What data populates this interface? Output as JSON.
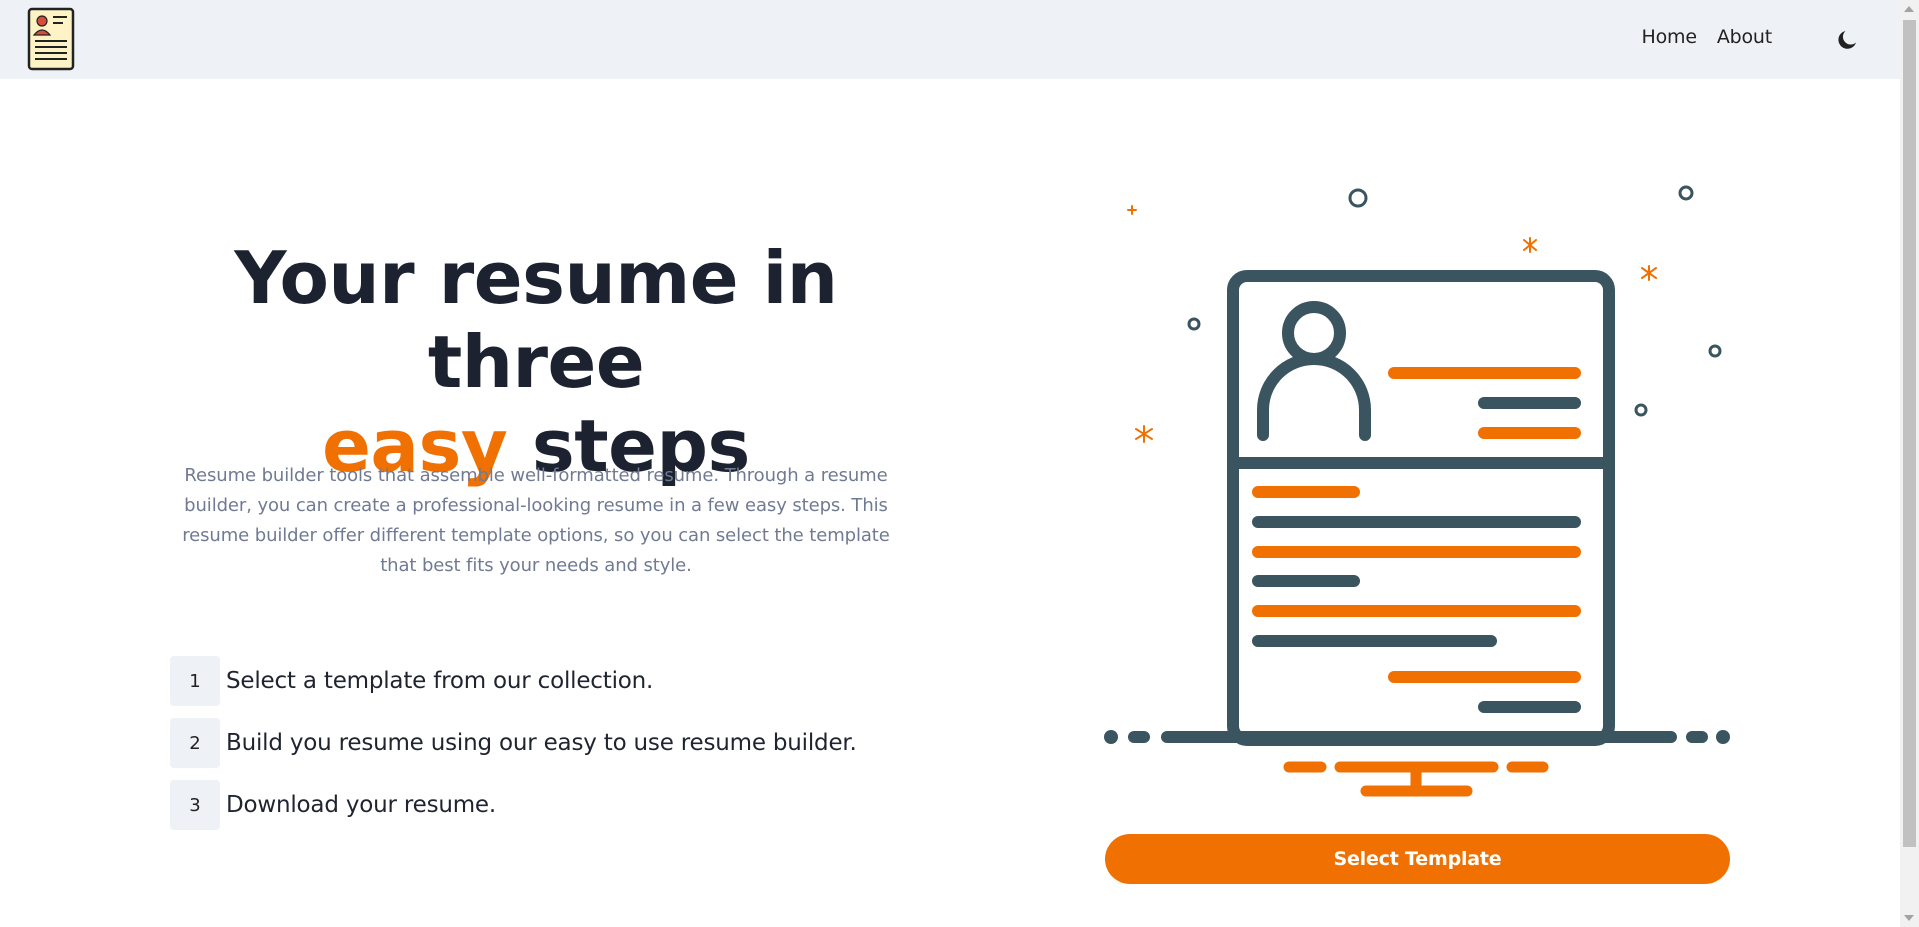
{
  "nav": {
    "links": [
      "Home",
      "About"
    ],
    "logo_icon": "resume-document-icon",
    "theme_icon": "moon-icon"
  },
  "hero": {
    "title_line1": "Your resume in three",
    "title_accent": "easy",
    "title_line2_rest": "steps",
    "description": "Resume builder tools that assemble well-formatted resume. Through a resume builder, you can create a professional-looking resume in a few easy steps. This resume builder offer different template options, so you can select the template that best fits your needs and style."
  },
  "steps": [
    {
      "number": "1",
      "text": "Select a template from our collection."
    },
    {
      "number": "2",
      "text": "Build you resume using our easy to use resume builder."
    },
    {
      "number": "3",
      "text": "Download your resume."
    }
  ],
  "cta": {
    "label": "Select Template"
  },
  "colors": {
    "accent": "#f07102",
    "dark": "#3a5560",
    "nav_bg": "#eef2f6",
    "text_muted": "#707a92"
  }
}
